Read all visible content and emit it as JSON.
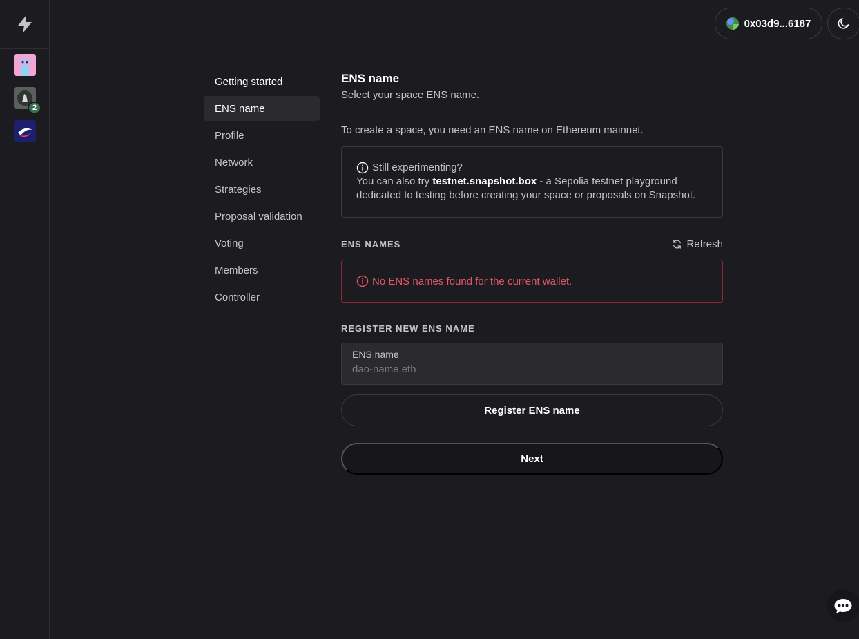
{
  "header": {
    "wallet_address": "0x03d9...6187",
    "logo_icon": "lightning-bolt-icon",
    "theme_icon": "moon-icon"
  },
  "rail": {
    "spaces": [
      {
        "icon": "space-avatar-1"
      },
      {
        "icon": "space-avatar-2",
        "badge": "2"
      },
      {
        "icon": "space-avatar-3"
      }
    ]
  },
  "sidenav": {
    "items": [
      {
        "label": "Getting started"
      },
      {
        "label": "ENS name"
      },
      {
        "label": "Profile"
      },
      {
        "label": "Network"
      },
      {
        "label": "Strategies"
      },
      {
        "label": "Proposal validation"
      },
      {
        "label": "Voting"
      },
      {
        "label": "Members"
      },
      {
        "label": "Controller"
      }
    ]
  },
  "main": {
    "title": "ENS name",
    "subtitle": "Select your space ENS name.",
    "intro": "To create a space, you need an ENS name on Ethereum mainnet.",
    "info": {
      "heading": "Still experimenting?",
      "text_before": "You can also try ",
      "link": "testnet.snapshot.box",
      "text_after": " - a Sepolia testnet playground dedicated to testing before creating your space or proposals on Snapshot."
    },
    "ens_names_label": "ENS NAMES",
    "refresh_label": "Refresh",
    "error": "No ENS names found for the current wallet.",
    "register_label": "REGISTER NEW ENS NAME",
    "input": {
      "label": "ENS name",
      "placeholder": "dao-name.eth",
      "value": ""
    },
    "register_button": "Register ENS name",
    "next_button": "Next"
  },
  "colors": {
    "background": "#1c1b20",
    "border": "#3a3a40",
    "error": "#e5566a",
    "badge": "#3a6f4f"
  }
}
